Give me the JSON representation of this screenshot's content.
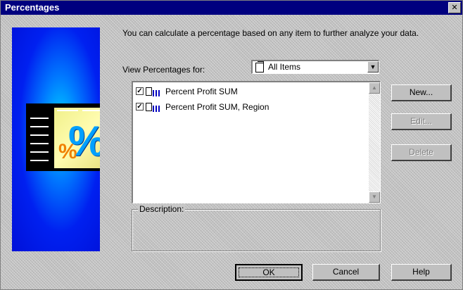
{
  "window": {
    "title": "Percentages",
    "close_glyph": "✕"
  },
  "graphic": {
    "big_symbol": "%",
    "small_symbol": "%",
    "colors": {
      "accent": "#00a0ff",
      "background": "#0020f0"
    }
  },
  "intro_text": "You can calculate a percentage based on any item to further analyze your data.",
  "view_for": {
    "label": "View Percentages for:",
    "selected": "All Items"
  },
  "list": {
    "items": [
      {
        "label": "Percent Profit SUM",
        "checked": true
      },
      {
        "label": "Percent Profit SUM, Region",
        "checked": true
      }
    ]
  },
  "description": {
    "label": "Description:"
  },
  "side_buttons": {
    "new": "New...",
    "edit": "Edit...",
    "delete": "Delete"
  },
  "footer_buttons": {
    "ok": "OK",
    "cancel": "Cancel",
    "help": "Help"
  }
}
